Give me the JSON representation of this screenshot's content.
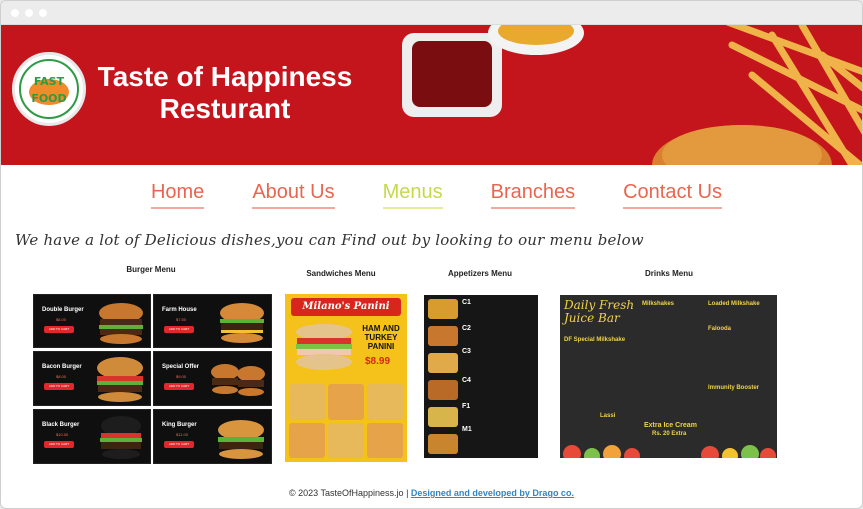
{
  "brand": {
    "title_line1": "Taste of Happiness",
    "title_line2": "Resturant",
    "logo_top": "FAST",
    "logo_bottom": "FOOD"
  },
  "nav": {
    "items": [
      {
        "label": "Home"
      },
      {
        "label": "About Us"
      },
      {
        "label": "Menus"
      },
      {
        "label": "Branches"
      },
      {
        "label": "Contact Us"
      }
    ]
  },
  "tagline": "We have a lot of Delicious dishes,you can Find out by looking to our menu below",
  "menus": {
    "burger": {
      "title": "Burger Menu",
      "items": [
        {
          "name": "Double Burger",
          "price": "$8.00",
          "button": "ADD TO CART"
        },
        {
          "name": "Farm House",
          "price": "$7.50",
          "button": "ADD TO CART"
        },
        {
          "name": "Bacon Burger",
          "price": "$8.00",
          "button": "ADD TO CART"
        },
        {
          "name": "Special Offer",
          "price": "$9.00",
          "button": "ADD TO CART"
        },
        {
          "name": "Black Burger",
          "price": "$10.00",
          "button": "ADD TO CART"
        },
        {
          "name": "King Burger",
          "price": "$11.00",
          "button": "ADD TO CART"
        }
      ]
    },
    "sandwiches": {
      "title": "Sandwiches Menu",
      "header": "Milano's Panini",
      "promo": "HAM AND TURKEY PANINI",
      "promo_price": "$8.99"
    },
    "appetizers": {
      "title": "Appetizers Menu",
      "codes": [
        "C1",
        "C2",
        "C3",
        "C4",
        "F1",
        "M1"
      ]
    },
    "drinks": {
      "title": "Drinks Menu",
      "header_line1": "Daily Fresh",
      "header_line2": "Juice Bar",
      "sections": [
        "Milkshakes",
        "Loaded Milkshake",
        "Falooda",
        "DF Special Milkshake",
        "Immunity Booster",
        "Lassi"
      ],
      "footer_promo": "Extra Ice Cream",
      "footer_price": "Rs. 20 Extra"
    }
  },
  "footer": {
    "copyright": "© 2023 TasteOfHappiness.jo | ",
    "link": "Designed and developed by Drago co."
  },
  "colors": {
    "hero_red": "#c4141c",
    "nav_link": "#e8664f",
    "nav_active": "#c6d94a",
    "footer_link": "#2f86c8"
  }
}
